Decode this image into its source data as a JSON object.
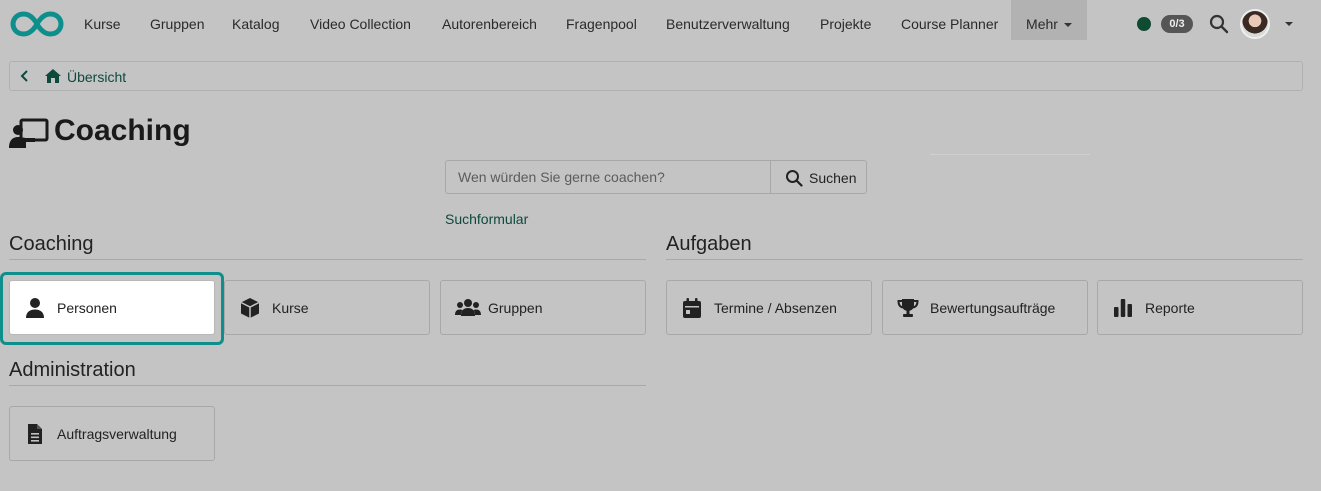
{
  "nav": {
    "items": [
      "Kurse",
      "Gruppen",
      "Katalog",
      "Video Collection",
      "Autorenbereich",
      "Fragenpool",
      "Benutzerverwaltung",
      "Projekte",
      "Course Planner"
    ],
    "more_label": "Mehr",
    "badge": "0/3",
    "status_color": "#0f4a32"
  },
  "breadcrumb": {
    "label": "Übersicht"
  },
  "page": {
    "title": "Coaching"
  },
  "search": {
    "placeholder": "Wen würden Sie gerne coachen?",
    "button_label": "Suchen",
    "form_link": "Suchformular"
  },
  "sections": {
    "coaching": {
      "heading": "Coaching",
      "tiles": [
        {
          "label": "Personen",
          "icon": "user-icon"
        },
        {
          "label": "Kurse",
          "icon": "cube-icon"
        },
        {
          "label": "Gruppen",
          "icon": "users-icon"
        }
      ]
    },
    "aufgaben": {
      "heading": "Aufgaben",
      "tiles": [
        {
          "label": "Termine / Absenzen",
          "icon": "calendar-icon"
        },
        {
          "label": "Bewertungsaufträge",
          "icon": "trophy-icon"
        },
        {
          "label": "Reporte",
          "icon": "bar-chart-icon"
        }
      ]
    },
    "administration": {
      "heading": "Administration",
      "tiles": [
        {
          "label": "Auftragsverwaltung",
          "icon": "document-icon"
        }
      ]
    }
  },
  "colors": {
    "accent": "#0f8f8c",
    "link": "#0d4a3b",
    "background": "#c4c4c4"
  }
}
